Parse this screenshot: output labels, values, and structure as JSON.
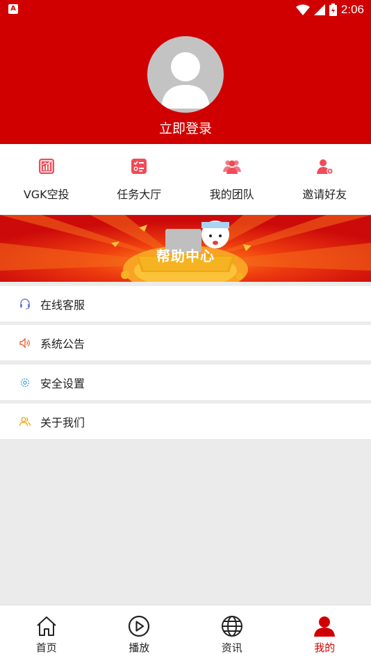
{
  "status_bar": {
    "time": "2:06",
    "notification_letter": "A"
  },
  "header": {
    "login_text": "立即登录"
  },
  "quick_menu": [
    {
      "label": "VGK空投",
      "icon": "chart-icon"
    },
    {
      "label": "任务大厅",
      "icon": "task-list-icon"
    },
    {
      "label": "我的团队",
      "icon": "team-icon"
    },
    {
      "label": "邀请好友",
      "icon": "invite-user-icon"
    }
  ],
  "banner": {
    "title": "帮助中心"
  },
  "list": [
    {
      "label": "在线客服",
      "icon": "headset-icon"
    },
    {
      "label": "系统公告",
      "icon": "speaker-icon"
    },
    {
      "label": "安全设置",
      "icon": "gear-icon"
    },
    {
      "label": "关于我们",
      "icon": "people-icon"
    }
  ],
  "bottom_nav": [
    {
      "label": "首页",
      "icon": "home-icon"
    },
    {
      "label": "播放",
      "icon": "play-icon"
    },
    {
      "label": "资讯",
      "icon": "globe-icon"
    },
    {
      "label": "我的",
      "icon": "user-icon",
      "active": true
    }
  ],
  "colors": {
    "brand_red": "#d10000",
    "background": "#ebebeb"
  }
}
